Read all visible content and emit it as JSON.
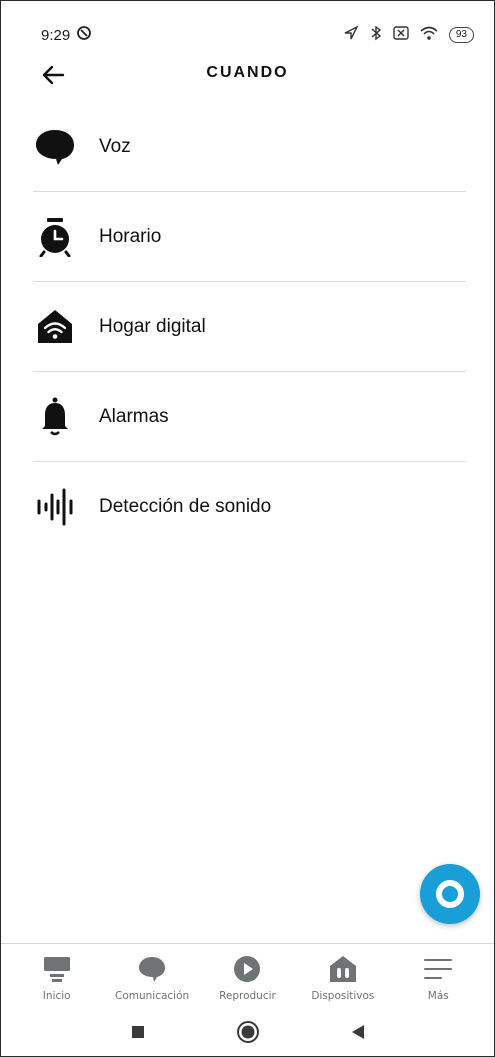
{
  "status_bar": {
    "time": "9:29",
    "battery": "93"
  },
  "header": {
    "title": "CUANDO",
    "back_icon": "arrow-left-icon"
  },
  "list": [
    {
      "label": "Voz",
      "icon": "speech-bubble-icon"
    },
    {
      "label": "Horario",
      "icon": "alarm-clock-icon"
    },
    {
      "label": "Hogar digital",
      "icon": "smart-home-icon"
    },
    {
      "label": "Alarmas",
      "icon": "bell-icon"
    },
    {
      "label": "Detección de sonido",
      "icon": "sound-wave-icon"
    }
  ],
  "fab": {
    "icon": "alexa-icon",
    "color": "#1a9ed8"
  },
  "bottom_nav": [
    {
      "label": "Inicio",
      "icon": "home-icon"
    },
    {
      "label": "Comunicación",
      "icon": "chat-icon"
    },
    {
      "label": "Reproducir",
      "icon": "play-icon"
    },
    {
      "label": "Dispositivos",
      "icon": "devices-icon"
    },
    {
      "label": "Más",
      "icon": "menu-icon"
    }
  ],
  "system_nav": {
    "recent_icon": "square-icon",
    "home_icon": "circle-icon",
    "back_icon": "triangle-back-icon"
  }
}
